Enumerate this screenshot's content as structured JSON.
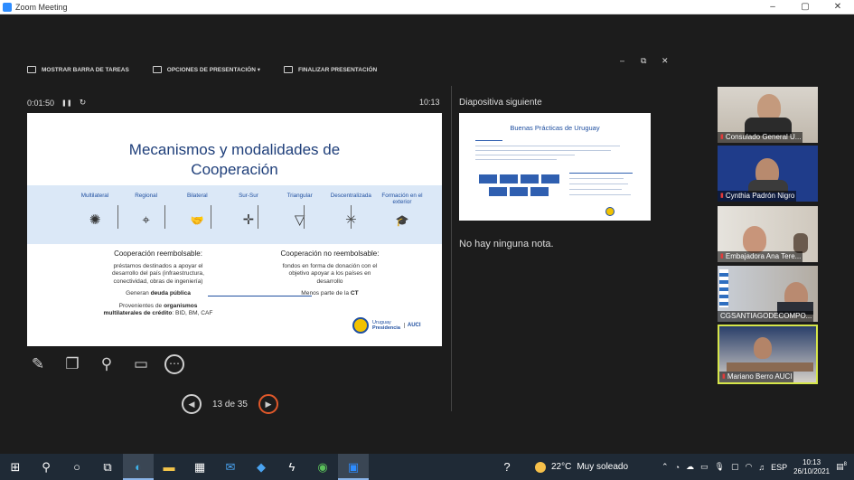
{
  "window": {
    "title": "Zoom Meeting",
    "controls": [
      "–",
      "▢",
      "✕"
    ]
  },
  "presenter_toolbar": {
    "items": [
      {
        "label": "MOSTRAR BARRA DE TAREAS",
        "icon": "taskbar-icon"
      },
      {
        "label": "OPCIONES DE PRESENTACIÓN ▾",
        "icon": "presentation-options-icon"
      },
      {
        "label": "FINALIZAR PRESENTACIÓN",
        "icon": "end-presentation-icon"
      }
    ],
    "window_controls": [
      "–",
      "⧉",
      "✕"
    ]
  },
  "timer": {
    "elapsed": "0:01:50",
    "pause": "❚❚",
    "reset": "↻"
  },
  "clock": "10:13",
  "slide": {
    "title_line1": "Mecanismos y modalidades de",
    "title_line2": "Cooperación",
    "modalities": [
      {
        "label": "Multilateral",
        "icon": "globe-network-icon",
        "glyph": "✺"
      },
      {
        "label": "Regional",
        "icon": "location-pin-icon",
        "glyph": "⌖"
      },
      {
        "label": "Bilateral",
        "icon": "handshake-icon",
        "glyph": "🤝"
      },
      {
        "label": "Sur-Sur",
        "icon": "compass-arrows-icon",
        "glyph": "✛"
      },
      {
        "label": "Triangular",
        "icon": "triangle-nodes-icon",
        "glyph": "▽"
      },
      {
        "label": "Descentralizada",
        "icon": "decentralized-nodes-icon",
        "glyph": "✳"
      },
      {
        "label": "Formación en el exterior",
        "icon": "graduation-cap-icon",
        "glyph": "🎓"
      }
    ],
    "left": {
      "heading": "Cooperación reembolsable:",
      "line1": "préstamos destinados a apoyar el",
      "line2": "desarrollo del país (infraestructura,",
      "line3": "conectividad, obras de ingeniería)",
      "debt_prefix": "Generan ",
      "debt_bold": "deuda pública",
      "src_prefix": "Provenientes de ",
      "src_bold1": "organismos",
      "src_bold2": "multilaterales de crédito",
      "src_suffix": ": BID, BM, CAF"
    },
    "right": {
      "heading": "Cooperación no reembolsable:",
      "line1": "fondos en forma de donación con el",
      "line2": "objetivo apoyar a los países en",
      "line3": "desarrollo",
      "ct_prefix": "Menos parte de la ",
      "ct_bold": "CT"
    },
    "logo": {
      "line1": "Uruguay",
      "line2": "Presidencia",
      "agency": "AUCI"
    }
  },
  "tools": [
    {
      "name": "pen-icon",
      "glyph": "✎"
    },
    {
      "name": "all-slides-icon",
      "glyph": "❐"
    },
    {
      "name": "zoom-icon",
      "glyph": "⚲"
    },
    {
      "name": "screen-icon",
      "glyph": "▭"
    },
    {
      "name": "more-icon",
      "glyph": "⋯"
    }
  ],
  "navigation": {
    "prev": "◀",
    "counter": "13 de 35",
    "next": "▶"
  },
  "next_slide": {
    "label": "Diapositiva siguiente",
    "title": "Buenas Prácticas de Uruguay"
  },
  "notes": "No hay ninguna nota.",
  "participants": [
    {
      "name": "Consulado General U...",
      "muted": true
    },
    {
      "name": "Cynthia Padrón Nigro",
      "muted": true
    },
    {
      "name": "Embajadora Ana Tere...",
      "muted": true
    },
    {
      "name": "CGSANTIAGODECOMPO...",
      "muted": false
    },
    {
      "name": "Mariano Berro AUCI",
      "muted": true
    }
  ],
  "taskbar": {
    "weather": {
      "temp": "22°C",
      "desc": "Muy soleado"
    },
    "lang": "ESP",
    "time": "10:13",
    "date": "26/10/2021",
    "notif": "8"
  }
}
